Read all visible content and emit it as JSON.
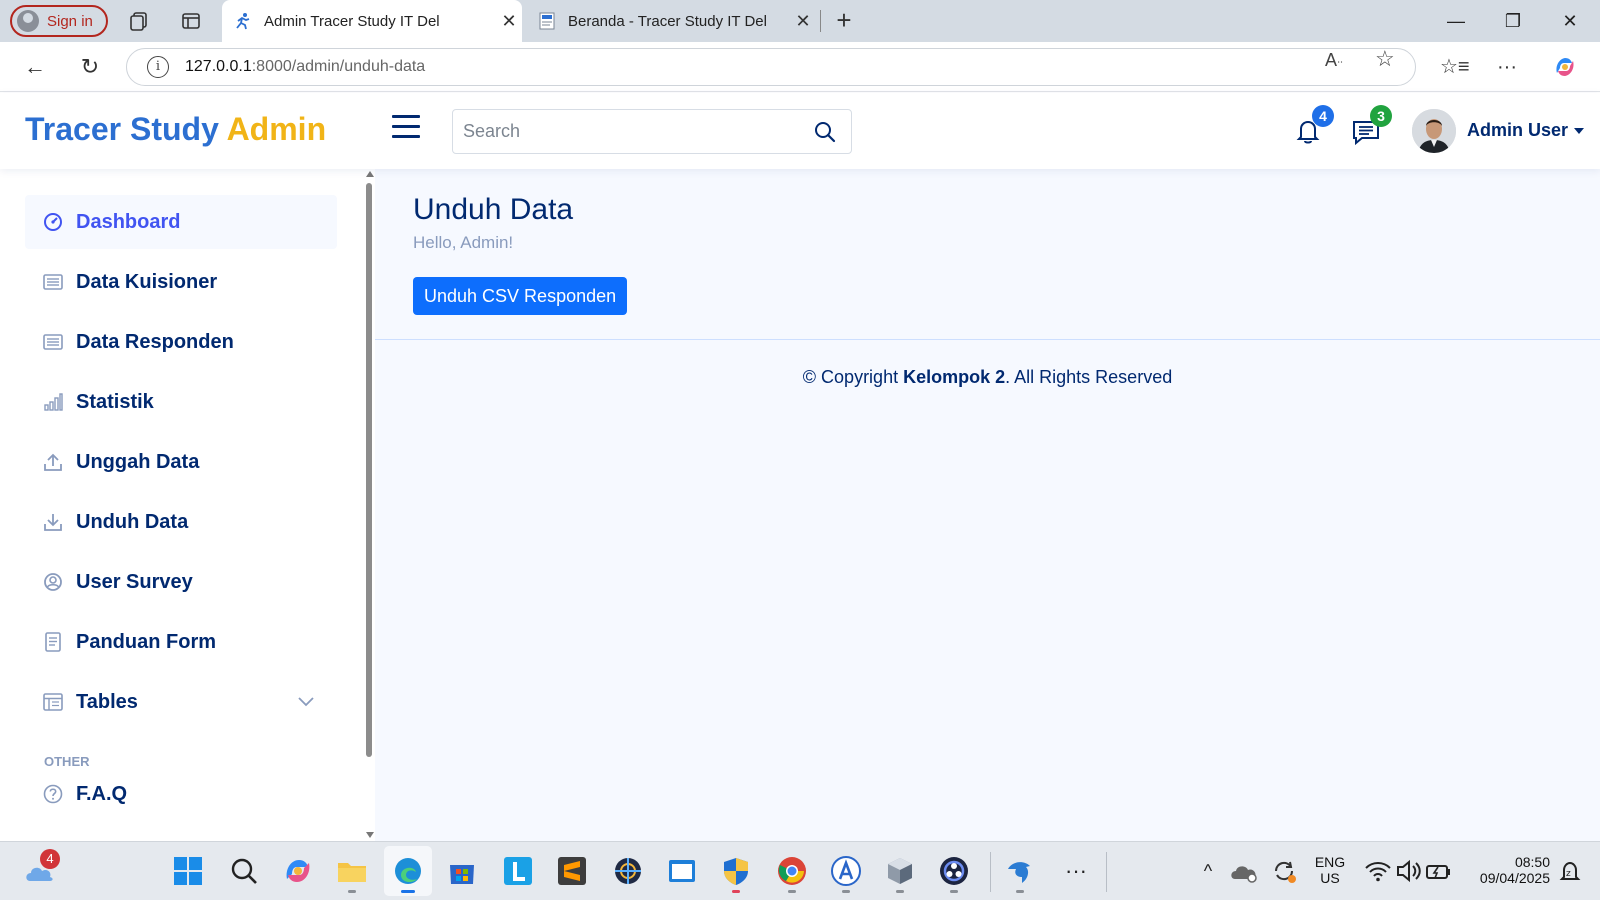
{
  "browser": {
    "signin_label": "Sign in",
    "tabs": [
      {
        "title": "Admin Tracer Study IT Del",
        "active": true
      },
      {
        "title": "Beranda - Tracer Study IT Del",
        "active": false
      }
    ],
    "url_host": "127.0.0.1",
    "url_path": ":8000/admin/unduh-data"
  },
  "header": {
    "brand_part1": "Tracer Study",
    "brand_part2": "Admin",
    "search_placeholder": "Search",
    "notifications_count": "4",
    "messages_count": "3",
    "user_name": "Admin User"
  },
  "sidebar": {
    "items": [
      {
        "label": "Dashboard",
        "icon": "speedometer-icon"
      },
      {
        "label": "Data Kuisioner",
        "icon": "list-icon"
      },
      {
        "label": "Data Responden",
        "icon": "list-icon"
      },
      {
        "label": "Statistik",
        "icon": "bar-chart-icon"
      },
      {
        "label": "Unggah Data",
        "icon": "upload-icon"
      },
      {
        "label": "Unduh Data",
        "icon": "download-icon"
      },
      {
        "label": "User Survey",
        "icon": "person-circle-icon"
      },
      {
        "label": "Panduan Form",
        "icon": "document-icon"
      },
      {
        "label": "Tables",
        "icon": "table-icon"
      }
    ],
    "heading_other": "OTHER",
    "faq_label": "F.A.Q"
  },
  "main": {
    "title": "Unduh Data",
    "greeting": "Hello, Admin!",
    "download_button": "Unduh CSV Responden",
    "copyright_prefix": "© Copyright",
    "copyright_owner": "Kelompok 2",
    "copyright_suffix": ". All Rights Reserved"
  },
  "taskbar": {
    "weather_badge": "4",
    "lang_top": "ENG",
    "lang_bottom": "US",
    "time": "08:50",
    "date": "09/04/2025"
  },
  "colors": {
    "brand_blue": "#2c6fd1",
    "brand_yellow": "#f1b417",
    "nav_text": "#012970",
    "active_nav": "#4154f1",
    "button_blue": "#0d6efd"
  }
}
